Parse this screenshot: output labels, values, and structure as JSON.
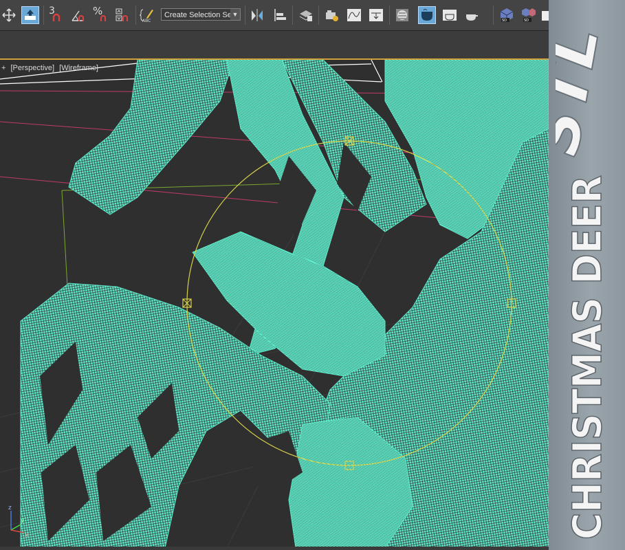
{
  "toolbar": {
    "selection_set": {
      "value": "Create Selection Se"
    },
    "angle_snap_value": "3",
    "percent_snap_symbol": "%",
    "edit_named_sets_label": "ABC",
    "icons": [
      "select-and-move-icon",
      "select-and-link-icon",
      "snaps-toggle-icon",
      "angle-snap-icon",
      "percent-snap-icon",
      "spinner-snap-icon",
      "edit-named-selection-sets-icon",
      "mirror-icon",
      "align-icon",
      "layer-manager-icon",
      "scene-explorer-icon",
      "curve-editor-icon",
      "schematic-view-icon",
      "material-editor-icon",
      "render-setup-icon",
      "rendered-frame-window-icon",
      "render-production-icon",
      "sd-cube-icon",
      "sd-cube-multi-icon"
    ]
  },
  "viewport": {
    "label": {
      "plus": "+",
      "view": "[Perspective]",
      "shading": "[Wireframe]"
    },
    "wireframe_color": "#5ee8c8",
    "gizmo_color": "#d8d24a",
    "active_border_color": "#d2a13a",
    "axis_labels": {
      "x": "x",
      "y": "y",
      "z": "z"
    }
  },
  "side_panel": {
    "brand": "STL",
    "title": "CHRISTMAS DEER"
  }
}
